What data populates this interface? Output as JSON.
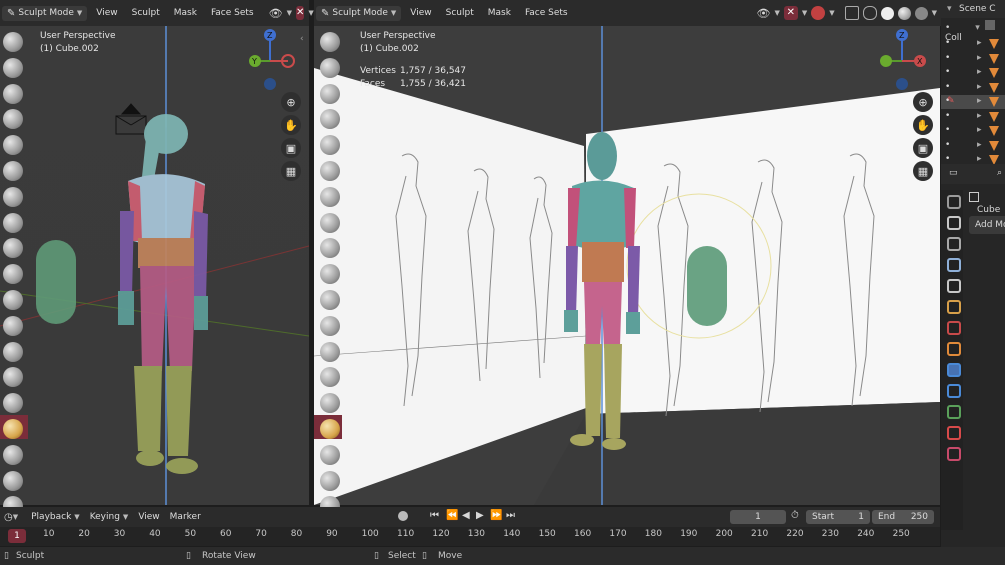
{
  "left_header": {
    "mode": "Sculpt Mode",
    "menu": [
      "View",
      "Sculpt",
      "Mask",
      "Face Sets"
    ]
  },
  "right_header": {
    "mode": "Sculpt Mode",
    "menu": [
      "View",
      "Sculpt",
      "Mask",
      "Face Sets"
    ]
  },
  "left_viewport": {
    "line1": "User Perspective",
    "line2": "(1) Cube.002"
  },
  "right_viewport": {
    "line1": "User Perspective",
    "line2": "(1) Cube.002",
    "vertices_label": "Vertices",
    "vertices_value": "1,757 / 36,547",
    "faces_label": "Faces",
    "faces_value": "1,755 / 36,421"
  },
  "gizmo": {
    "z": "Z",
    "y": "Y",
    "x": "X"
  },
  "timeline": {
    "playback": "Playback",
    "keying": "Keying",
    "view": "View",
    "marker": "Marker",
    "current_frame": "1",
    "start_label": "Start",
    "start_value": "1",
    "end_label": "End",
    "end_value": "250"
  },
  "ruler": {
    "current": "1",
    "ticks": [
      "10",
      "20",
      "30",
      "40",
      "50",
      "60",
      "70",
      "80",
      "90",
      "100",
      "110",
      "120",
      "130",
      "140",
      "150",
      "160",
      "170",
      "180",
      "190",
      "200",
      "210",
      "220",
      "230",
      "240",
      "250"
    ]
  },
  "status": {
    "mode": "Sculpt",
    "rotate": "Rotate View",
    "select": "Select",
    "move": "Move"
  },
  "outliner": {
    "scene": "Scene C",
    "collection": "Coll"
  },
  "properties": {
    "object": "Cube",
    "add_modifier": "Add Mo"
  },
  "colors": {
    "accent": "#4772b3",
    "active_red": "#7b2d3a",
    "outline_orange": "#e28a3a"
  }
}
